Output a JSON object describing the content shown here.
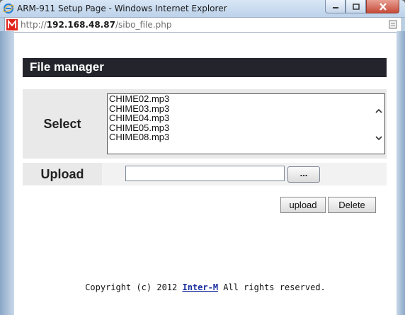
{
  "window": {
    "title": "ARM-911 Setup Page - Windows Internet Explorer",
    "url_prefix": "http://",
    "url_host": "192.168.48.87",
    "url_path": "/sibo_file.php"
  },
  "page": {
    "header": "File manager",
    "select_label": "Select",
    "upload_label": "Upload",
    "files": [
      "CHIME02.mp3",
      "CHIME03.mp3",
      "CHIME04.mp3",
      "CHIME05.mp3",
      "CHIME08.mp3"
    ],
    "file_input_value": "",
    "browse_label": "...",
    "upload_button": "upload",
    "delete_button": "Delete",
    "footer_prefix": "Copyright (c) 2012 ",
    "footer_link": "Inter-M",
    "footer_suffix": " All rights reserved."
  },
  "colors": {
    "header_bg": "#24252c",
    "label_bg": "#e9e9ea",
    "link": "#1a2fa0"
  },
  "icons": {
    "browser": "ie-icon",
    "site": "m-logo-icon",
    "page": "page-icon",
    "minimize": "minimize-icon",
    "maximize": "maximize-icon",
    "close": "close-icon",
    "scroll_up": "chevron-up-icon",
    "scroll_down": "chevron-down-icon"
  }
}
